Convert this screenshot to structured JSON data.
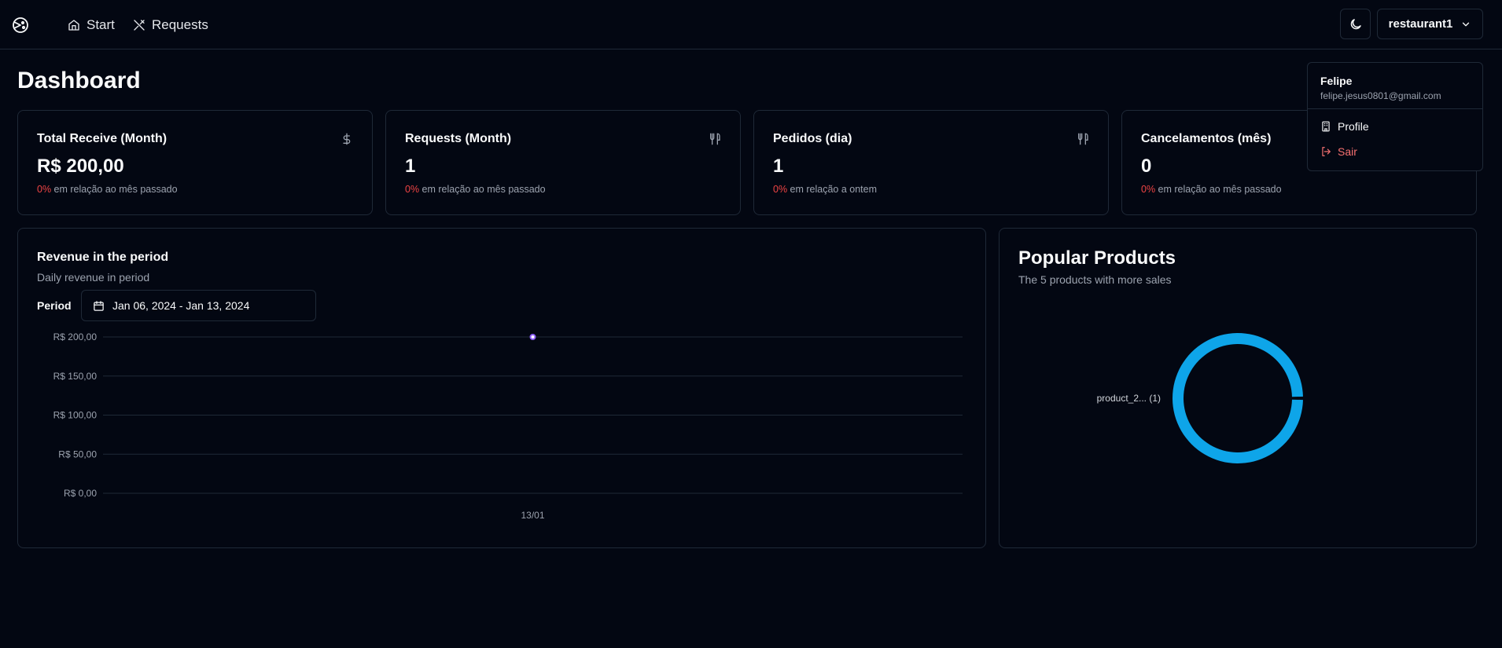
{
  "header": {
    "nav": [
      {
        "label": "Start",
        "icon": "home-icon"
      },
      {
        "label": "Requests",
        "icon": "utensils-crossed-icon"
      }
    ],
    "restaurant_select": "restaurant1"
  },
  "page_title": "Dashboard",
  "stats": [
    {
      "title": "Total Receive (Month)",
      "value": "R$ 200,00",
      "pct": "0%",
      "sub": " em relação ao mês passado",
      "icon": "dollar-icon"
    },
    {
      "title": "Requests (Month)",
      "value": "1",
      "pct": "0%",
      "sub": " em relação ao mês passado",
      "icon": "utensils-icon"
    },
    {
      "title": "Pedidos (dia)",
      "value": "1",
      "pct": "0%",
      "sub": " em relação a ontem",
      "icon": "utensils-icon"
    },
    {
      "title": "Cancelamentos (mês)",
      "value": "0",
      "pct": "0%",
      "sub": " em relação ao mês passado",
      "icon": "dollar-icon"
    }
  ],
  "revenue": {
    "title": "Revenue in the period",
    "subtitle": "Daily revenue in period",
    "period_label": "Period",
    "date_range": "Jan 06, 2024 - Jan 13, 2024"
  },
  "popular": {
    "title": "Popular Products",
    "subtitle": "The 5 products with more sales"
  },
  "dropdown": {
    "name": "Felipe",
    "email": "felipe.jesus0801@gmail.com",
    "profile_label": "Profile",
    "logout_label": "Sair"
  },
  "colors": {
    "accent_line": "#8b5cf6",
    "pie": "#0ea5e9",
    "negative": "#ef4444"
  },
  "chart_data": [
    {
      "type": "line",
      "x": [
        "13/01"
      ],
      "series": [
        {
          "values": [
            200
          ]
        }
      ],
      "yticks": [
        "R$ 200,00",
        "R$ 150,00",
        "R$ 100,00",
        "R$ 50,00",
        "R$ 0,00"
      ],
      "ytick_values": [
        200,
        150,
        100,
        50,
        0
      ],
      "ylim": [
        0,
        200
      ],
      "grid": true
    },
    {
      "type": "pie",
      "categories": [
        "product_2..."
      ],
      "values": [
        1
      ],
      "labels": [
        "product_2... (1)"
      ]
    }
  ]
}
